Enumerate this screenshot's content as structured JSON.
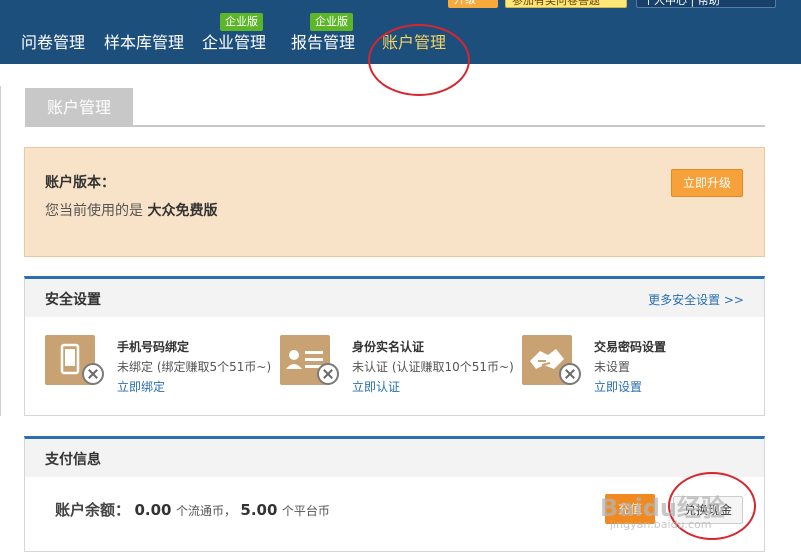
{
  "top_strip": {
    "upgrade": "升级",
    "follow": "参加有奖问卷答题",
    "dark": "个人中心 | 帮助"
  },
  "nav": {
    "items": [
      {
        "label": "问卷管理",
        "badge": ""
      },
      {
        "label": "样本库管理",
        "badge": ""
      },
      {
        "label": "企业管理",
        "badge": "企业版"
      },
      {
        "label": "报告管理",
        "badge": "企业版"
      },
      {
        "label": "账户管理",
        "badge": "",
        "active": true
      }
    ]
  },
  "tab": {
    "label": "账户管理"
  },
  "version": {
    "title": "账户版本：",
    "desc_prefix": "您当前使用的是",
    "desc_value": "大众免费版",
    "upgrade_button": "立即升级"
  },
  "security": {
    "title": "安全设置",
    "more_link": "更多安全设置 >>",
    "items": [
      {
        "icon": "phone-icon",
        "title": "手机号码绑定",
        "status": "未绑定 (绑定赚取5个51币~)",
        "action": "立即绑定"
      },
      {
        "icon": "id-card-icon",
        "title": "身份实名认证",
        "status": "未认证 (认证赚取10个51币~)",
        "action": "立即认证"
      },
      {
        "icon": "handshake-icon",
        "title": "交易密码设置",
        "status": "未设置",
        "action": "立即设置"
      }
    ]
  },
  "payment": {
    "title": "支付信息",
    "balance_label": "账户余额：",
    "amount1": "0.00",
    "unit1": "个流通币，",
    "amount2": "5.00",
    "unit2": "个平台币",
    "recharge_button": "充值",
    "exchange_button": "兑换现金"
  },
  "watermark": {
    "text": "Baidu经验",
    "sub": "jingyan.baidu.com"
  },
  "colors": {
    "nav_bg": "#1d4f7c",
    "active_nav": "#f6d365",
    "badge": "#5db52a",
    "accent_orange": "#f7a13b",
    "panel_top": "#2a6fb0",
    "annotation": "#d8262e"
  }
}
